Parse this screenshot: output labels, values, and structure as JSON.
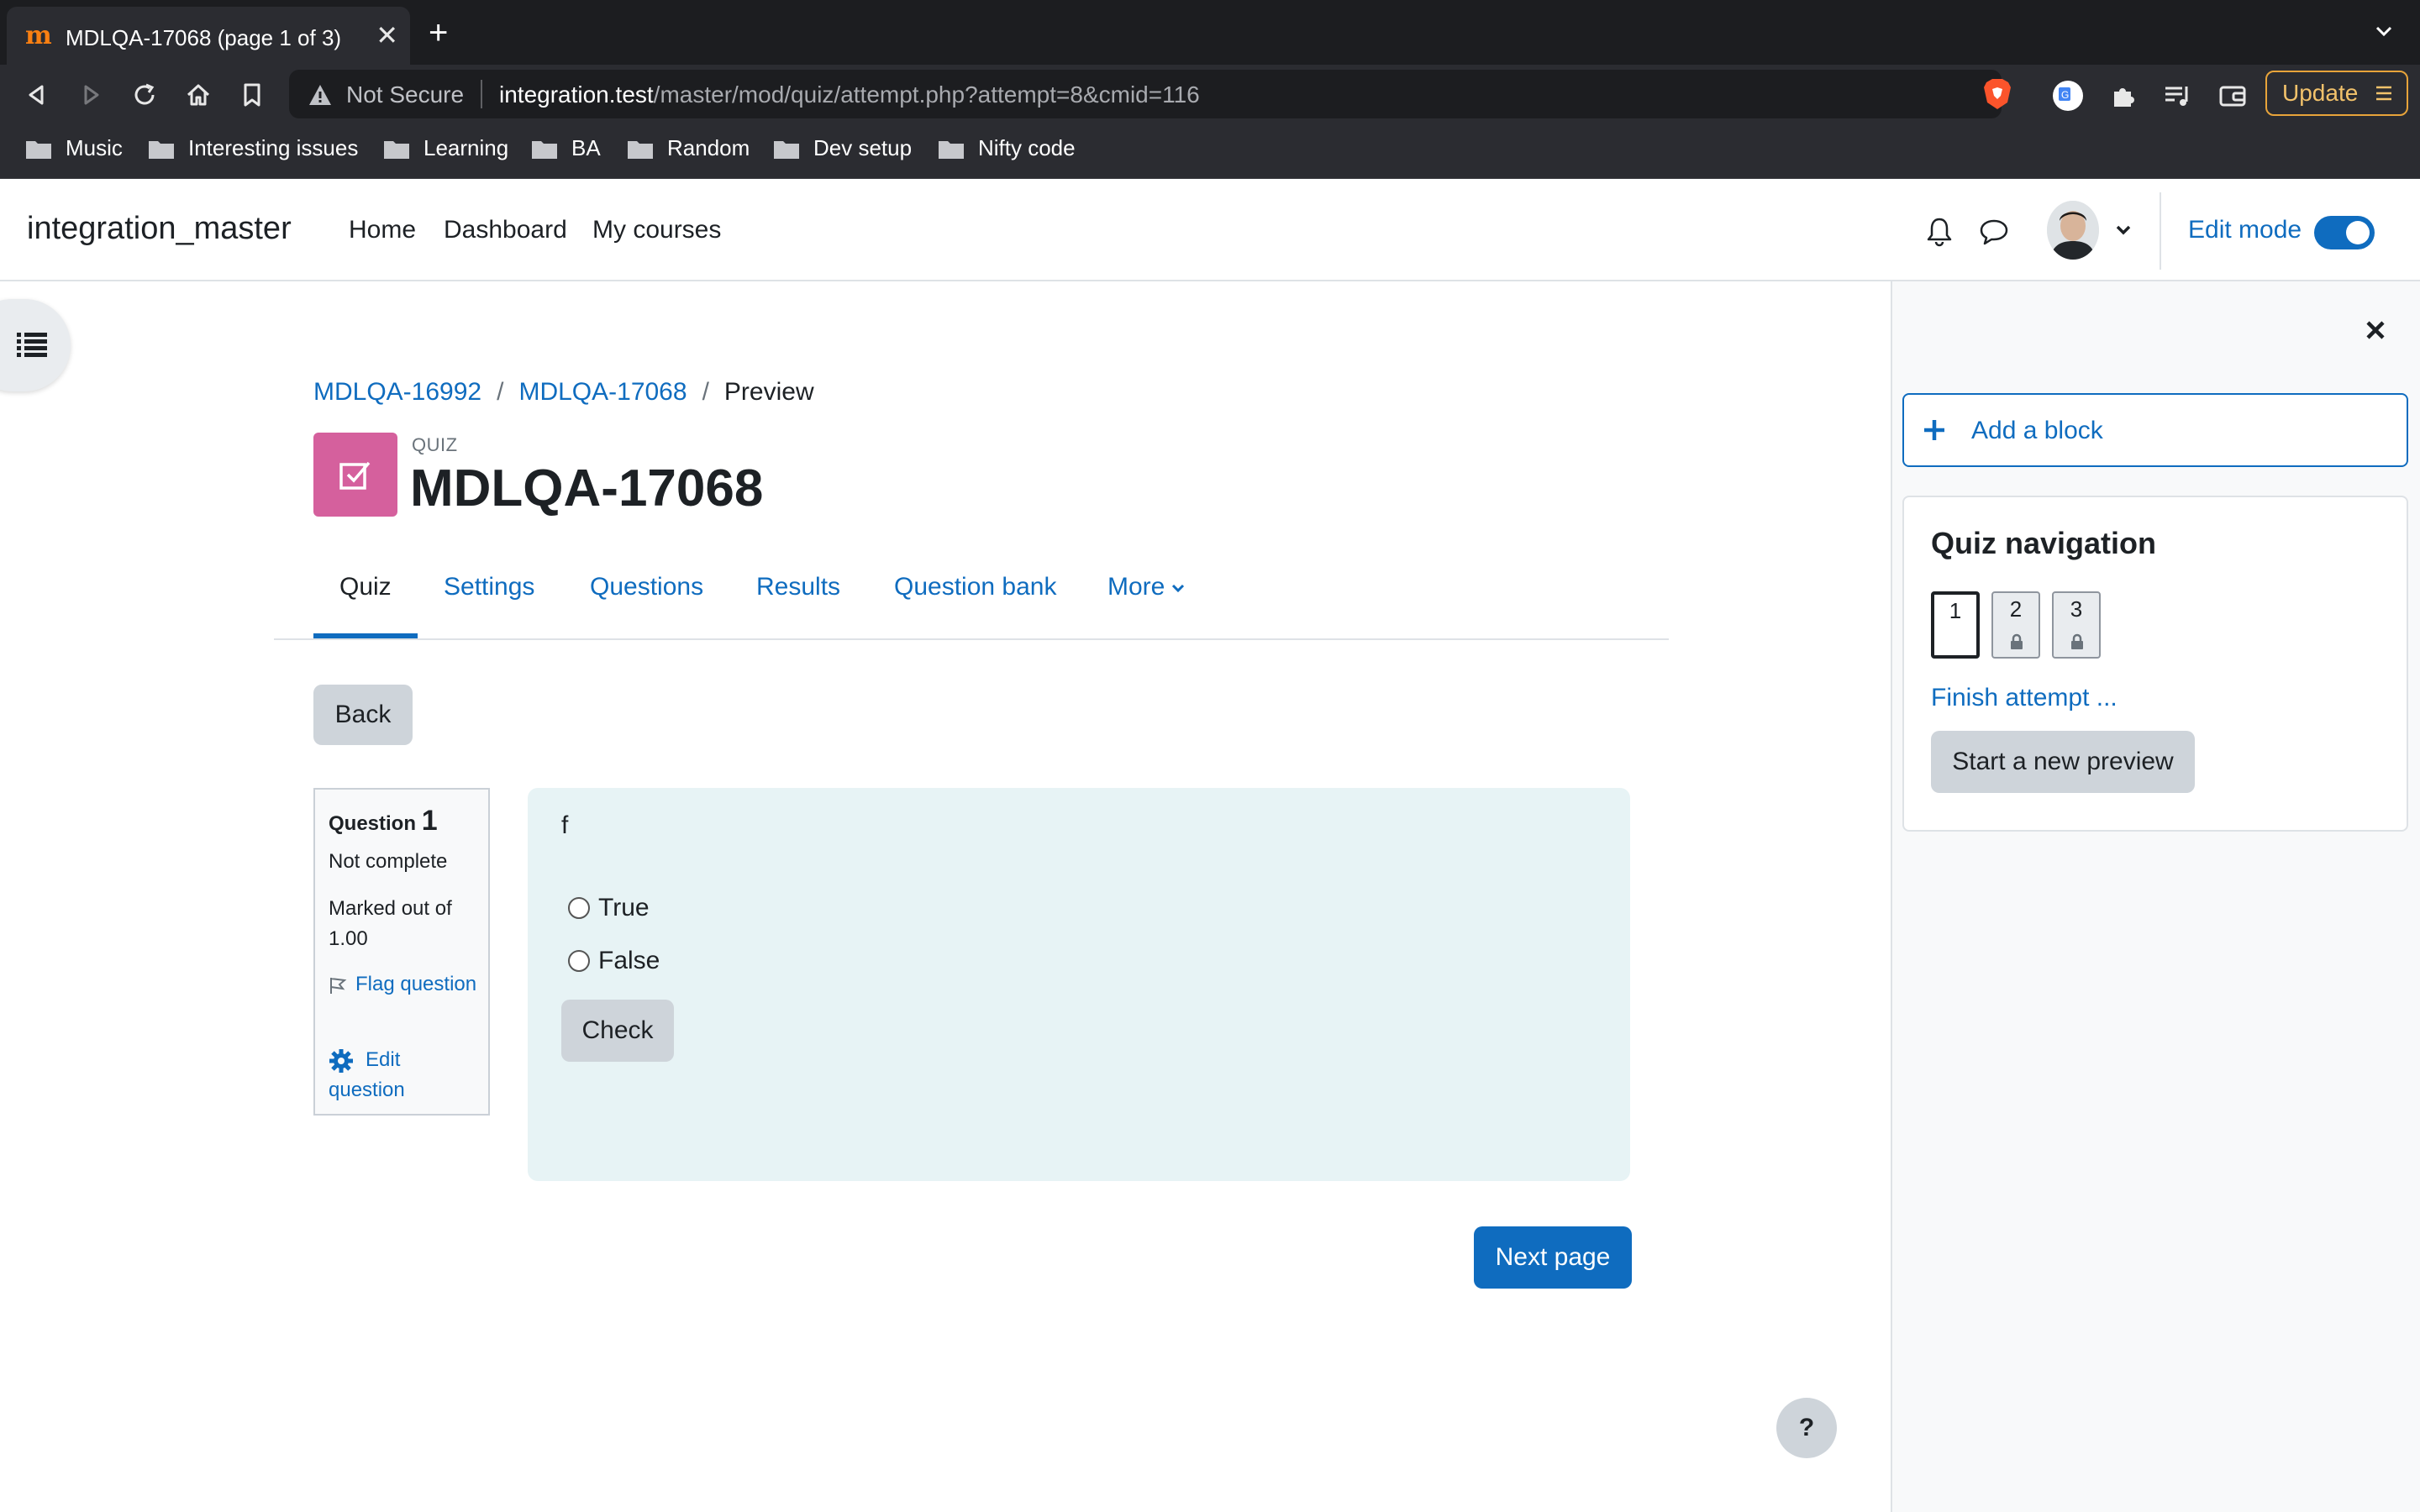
{
  "browser": {
    "tab_title": "MDLQA-17068 (page 1 of 3)",
    "tab_close": "✕",
    "new_tab": "+",
    "not_secure": "Not Secure",
    "url_host": "integration.test",
    "url_path": "/master/mod/quiz/attempt.php?attempt=8&cmid=116",
    "update_label": "Update",
    "bookmarks": [
      "Music",
      "Interesting issues",
      "Learning",
      "BA",
      "Random",
      "Dev setup",
      "Nifty code"
    ]
  },
  "navbar": {
    "site_name": "integration_master",
    "items": [
      "Home",
      "Dashboard",
      "My courses"
    ],
    "edit_mode_label": "Edit mode",
    "edit_mode_on": true
  },
  "breadcrumb": {
    "items": [
      "MDLQA-16992",
      "MDLQA-17068"
    ],
    "current": "Preview",
    "separator": "/"
  },
  "header": {
    "activity_kind": "QUIZ",
    "title": "MDLQA-17068"
  },
  "secondary_nav": {
    "tabs": [
      "Quiz",
      "Settings",
      "Questions",
      "Results",
      "Question bank",
      "More"
    ],
    "active": "Quiz"
  },
  "back_label": "Back",
  "question": {
    "label": "Question",
    "number": "1",
    "state": "Not complete",
    "grade": "Marked out of 1.00",
    "flag_label": "Flag question",
    "edit_label": "Edit question",
    "text": "f",
    "answers": [
      "True",
      "False"
    ],
    "check_label": "Check"
  },
  "next_label": "Next page",
  "help_label": "?",
  "drawer": {
    "add_block_label": "Add a block",
    "quiz_nav_title": "Quiz navigation",
    "nav_buttons": [
      "1",
      "2",
      "3"
    ],
    "finish_label": "Finish attempt ...",
    "new_preview_label": "Start a new preview"
  },
  "colors": {
    "primary": "#0f6cbf",
    "quiz_icon": "#d5609d",
    "question_bg": "#e7f3f5",
    "secondary_btn": "#ced4da"
  }
}
